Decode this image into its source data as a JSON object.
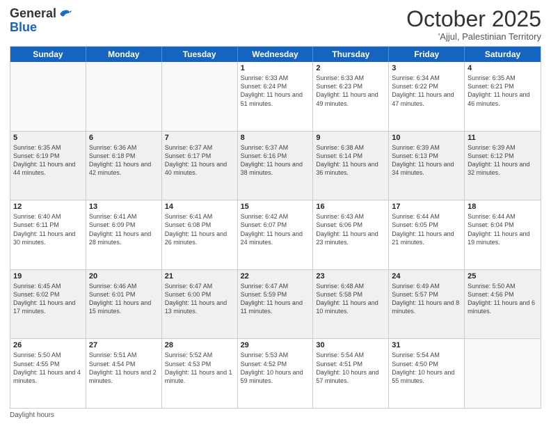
{
  "header": {
    "logo_line1": "General",
    "logo_line2": "Blue",
    "month": "October 2025",
    "location": "'Ajjul, Palestinian Territory"
  },
  "days_of_week": [
    "Sunday",
    "Monday",
    "Tuesday",
    "Wednesday",
    "Thursday",
    "Friday",
    "Saturday"
  ],
  "weeks": [
    [
      {
        "day": "",
        "empty": true
      },
      {
        "day": "",
        "empty": true
      },
      {
        "day": "",
        "empty": true
      },
      {
        "day": "1",
        "sunrise": "6:33 AM",
        "sunset": "6:24 PM",
        "daylight": "11 hours and 51 minutes."
      },
      {
        "day": "2",
        "sunrise": "6:33 AM",
        "sunset": "6:23 PM",
        "daylight": "11 hours and 49 minutes."
      },
      {
        "day": "3",
        "sunrise": "6:34 AM",
        "sunset": "6:22 PM",
        "daylight": "11 hours and 47 minutes."
      },
      {
        "day": "4",
        "sunrise": "6:35 AM",
        "sunset": "6:21 PM",
        "daylight": "11 hours and 46 minutes."
      }
    ],
    [
      {
        "day": "5",
        "sunrise": "6:35 AM",
        "sunset": "6:19 PM",
        "daylight": "11 hours and 44 minutes."
      },
      {
        "day": "6",
        "sunrise": "6:36 AM",
        "sunset": "6:18 PM",
        "daylight": "11 hours and 42 minutes."
      },
      {
        "day": "7",
        "sunrise": "6:37 AM",
        "sunset": "6:17 PM",
        "daylight": "11 hours and 40 minutes."
      },
      {
        "day": "8",
        "sunrise": "6:37 AM",
        "sunset": "6:16 PM",
        "daylight": "11 hours and 38 minutes."
      },
      {
        "day": "9",
        "sunrise": "6:38 AM",
        "sunset": "6:14 PM",
        "daylight": "11 hours and 36 minutes."
      },
      {
        "day": "10",
        "sunrise": "6:39 AM",
        "sunset": "6:13 PM",
        "daylight": "11 hours and 34 minutes."
      },
      {
        "day": "11",
        "sunrise": "6:39 AM",
        "sunset": "6:12 PM",
        "daylight": "11 hours and 32 minutes."
      }
    ],
    [
      {
        "day": "12",
        "sunrise": "6:40 AM",
        "sunset": "6:11 PM",
        "daylight": "11 hours and 30 minutes."
      },
      {
        "day": "13",
        "sunrise": "6:41 AM",
        "sunset": "6:09 PM",
        "daylight": "11 hours and 28 minutes."
      },
      {
        "day": "14",
        "sunrise": "6:41 AM",
        "sunset": "6:08 PM",
        "daylight": "11 hours and 26 minutes."
      },
      {
        "day": "15",
        "sunrise": "6:42 AM",
        "sunset": "6:07 PM",
        "daylight": "11 hours and 24 minutes."
      },
      {
        "day": "16",
        "sunrise": "6:43 AM",
        "sunset": "6:06 PM",
        "daylight": "11 hours and 23 minutes."
      },
      {
        "day": "17",
        "sunrise": "6:44 AM",
        "sunset": "6:05 PM",
        "daylight": "11 hours and 21 minutes."
      },
      {
        "day": "18",
        "sunrise": "6:44 AM",
        "sunset": "6:04 PM",
        "daylight": "11 hours and 19 minutes."
      }
    ],
    [
      {
        "day": "19",
        "sunrise": "6:45 AM",
        "sunset": "6:02 PM",
        "daylight": "11 hours and 17 minutes."
      },
      {
        "day": "20",
        "sunrise": "6:46 AM",
        "sunset": "6:01 PM",
        "daylight": "11 hours and 15 minutes."
      },
      {
        "day": "21",
        "sunrise": "6:47 AM",
        "sunset": "6:00 PM",
        "daylight": "11 hours and 13 minutes."
      },
      {
        "day": "22",
        "sunrise": "6:47 AM",
        "sunset": "5:59 PM",
        "daylight": "11 hours and 11 minutes."
      },
      {
        "day": "23",
        "sunrise": "6:48 AM",
        "sunset": "5:58 PM",
        "daylight": "11 hours and 10 minutes."
      },
      {
        "day": "24",
        "sunrise": "6:49 AM",
        "sunset": "5:57 PM",
        "daylight": "11 hours and 8 minutes."
      },
      {
        "day": "25",
        "sunrise": "5:50 AM",
        "sunset": "4:56 PM",
        "daylight": "11 hours and 6 minutes."
      }
    ],
    [
      {
        "day": "26",
        "sunrise": "5:50 AM",
        "sunset": "4:55 PM",
        "daylight": "11 hours and 4 minutes."
      },
      {
        "day": "27",
        "sunrise": "5:51 AM",
        "sunset": "4:54 PM",
        "daylight": "11 hours and 2 minutes."
      },
      {
        "day": "28",
        "sunrise": "5:52 AM",
        "sunset": "4:53 PM",
        "daylight": "11 hours and 1 minute."
      },
      {
        "day": "29",
        "sunrise": "5:53 AM",
        "sunset": "4:52 PM",
        "daylight": "10 hours and 59 minutes."
      },
      {
        "day": "30",
        "sunrise": "5:54 AM",
        "sunset": "4:51 PM",
        "daylight": "10 hours and 57 minutes."
      },
      {
        "day": "31",
        "sunrise": "5:54 AM",
        "sunset": "4:50 PM",
        "daylight": "10 hours and 55 minutes."
      },
      {
        "day": "",
        "empty": true
      }
    ]
  ],
  "footer": {
    "label": "Daylight hours"
  }
}
